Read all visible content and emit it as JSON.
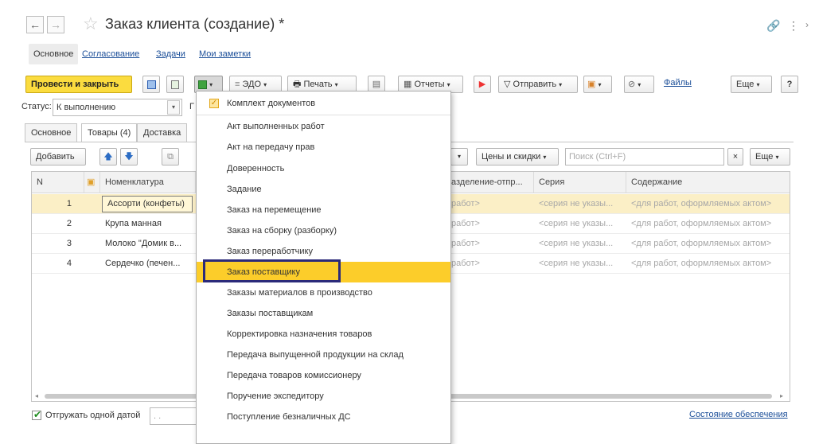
{
  "window": {
    "title": "Заказ клиента (создание) *",
    "back_icon": "←",
    "forward_icon": "→"
  },
  "top_tabs": [
    {
      "label": "Основное"
    },
    {
      "label": "Согласование"
    },
    {
      "label": "Задачи"
    },
    {
      "label": "Мои заметки"
    }
  ],
  "toolbar": {
    "post_close": "Провести и закрыть",
    "edo": "ЭДО",
    "print": "Печать",
    "reports": "Отчеты",
    "send": "Отправить",
    "files": "Файлы",
    "more": "Еще",
    "help": "?"
  },
  "status": {
    "label": "Статус:",
    "value": "К выполнению",
    "cut_label": "Г"
  },
  "inner_tabs": [
    {
      "label": "Основное"
    },
    {
      "label": "Товары (4)"
    },
    {
      "label": "Доставка"
    }
  ],
  "table_toolbar": {
    "add": "Добавить",
    "prices": "Цены и скидки",
    "search_placeholder": "Поиск (Ctrl+F)",
    "clear": "×",
    "more": "Еще"
  },
  "table": {
    "headers": {
      "n": "N",
      "nomenclature": "Номенклатура",
      "division": "азделение-отпр...",
      "series": "Серия",
      "content": "Содержание"
    },
    "rows": [
      {
        "n": "1",
        "name": "Ассорти (конфеты)",
        "division": "работ>",
        "series": "<серия не указы...",
        "content": "<для работ, оформляемых актом>"
      },
      {
        "n": "2",
        "name": "Крупа манная",
        "division": "работ>",
        "series": "<серия не указы...",
        "content": "<для работ, оформляемых актом>"
      },
      {
        "n": "3",
        "name": "Молоко \"Домик в...",
        "division": "работ>",
        "series": "<серия не указы...",
        "content": "<для работ, оформляемых актом>"
      },
      {
        "n": "4",
        "name": "Сердечко (печен...",
        "division": "работ>",
        "series": "<серия не указы...",
        "content": "<для работ, оформляемых актом>"
      }
    ]
  },
  "menu": {
    "items": [
      {
        "label": "Комплект документов"
      },
      {
        "label": "Акт выполненных работ"
      },
      {
        "label": "Акт на передачу прав"
      },
      {
        "label": "Доверенность"
      },
      {
        "label": "Задание"
      },
      {
        "label": "Заказ на перемещение"
      },
      {
        "label": "Заказ на сборку (разборку)"
      },
      {
        "label": "Заказ переработчику"
      },
      {
        "label": "Заказ поставщику"
      },
      {
        "label": "Заказы материалов в производство"
      },
      {
        "label": "Заказы поставщикам"
      },
      {
        "label": "Корректировка назначения товаров"
      },
      {
        "label": "Передача выпущенной продукции на склад"
      },
      {
        "label": "Передача товаров комиссионеру"
      },
      {
        "label": "Поручение экспедитору"
      },
      {
        "label": "Поступление безналичных ДС"
      }
    ]
  },
  "footer": {
    "ship_one_date": "Отгружать одной датой",
    "date_placeholder": " .  .",
    "supply_status": "Состояние обеспечения"
  },
  "colors": {
    "accent_yellow": "#fbdc3f",
    "highlight": "#fccd2a",
    "selected_row": "#fbefc6",
    "link": "#1c4f99",
    "frame": "#2b2a7a"
  }
}
